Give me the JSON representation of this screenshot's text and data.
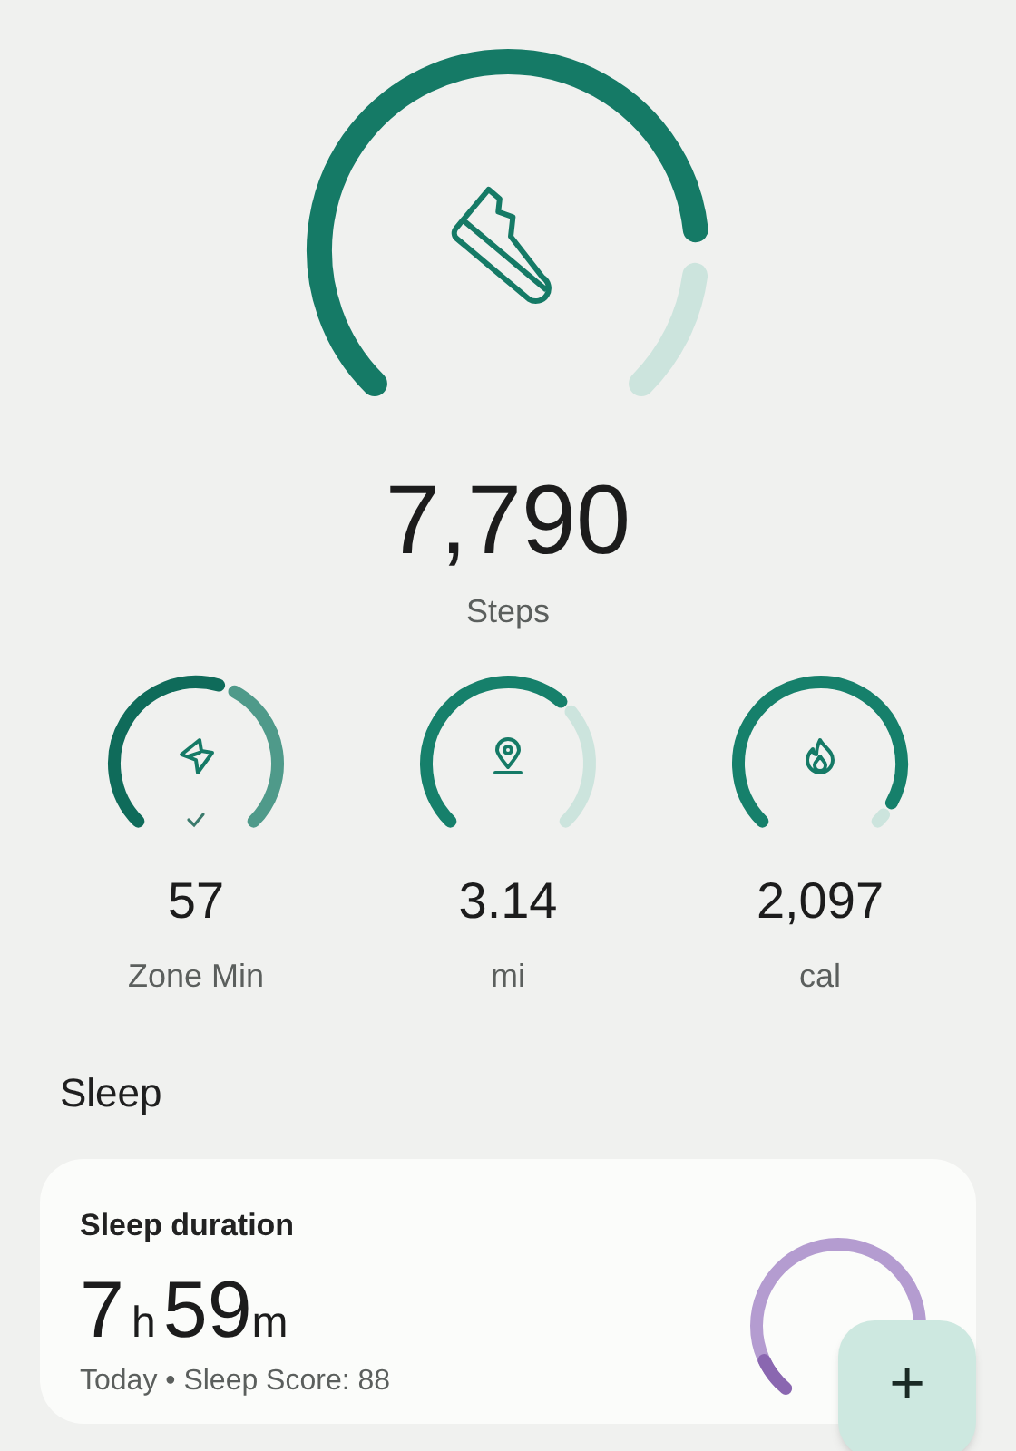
{
  "steps": {
    "value": "7,790",
    "label": "Steps"
  },
  "metrics": [
    {
      "kind": "zone",
      "value": "57",
      "label": "Zone Min",
      "goal_met": true
    },
    {
      "kind": "distance",
      "value": "3.14",
      "label": "mi",
      "goal_met": false
    },
    {
      "kind": "calories",
      "value": "2,097",
      "label": "cal",
      "goal_met": false
    }
  ],
  "section_title": "Sleep",
  "sleep_card": {
    "title": "Sleep duration",
    "hours": "7",
    "hours_unit": "h",
    "minutes": "59",
    "minutes_unit": "m",
    "subtitle": "Today • Sleep Score: 88"
  },
  "fab": {
    "label": "+"
  }
}
